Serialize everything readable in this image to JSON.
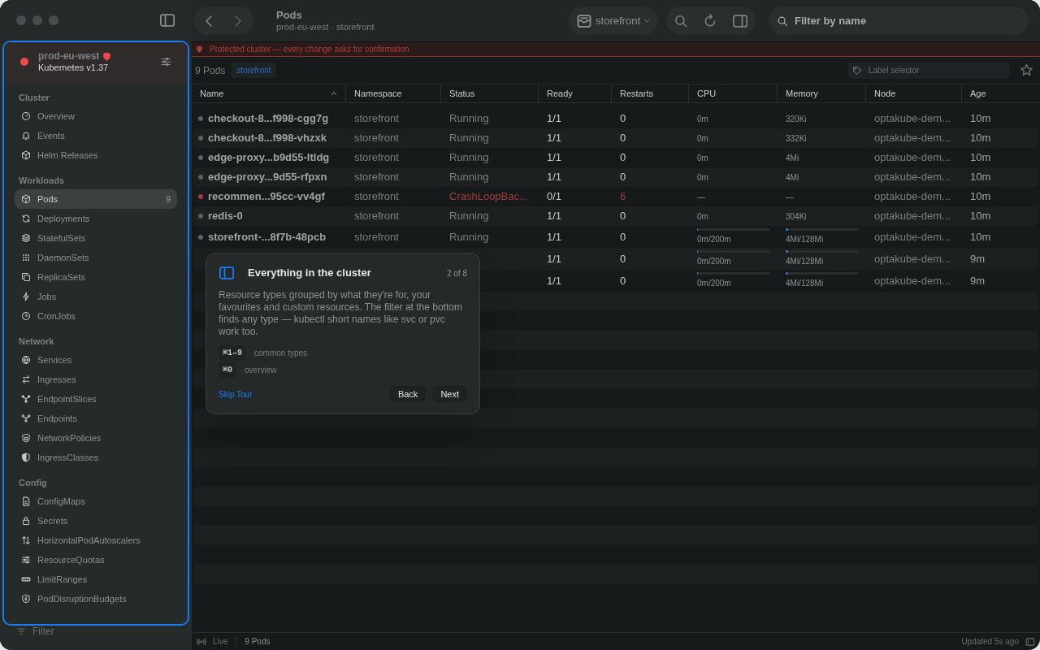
{
  "window": {
    "title": "Pods",
    "subtitle": "prod-eu-west · storefront"
  },
  "toolbar": {
    "namespace": "storefront",
    "search": {
      "placeholder": "Filter by name"
    }
  },
  "cluster": {
    "name": "prod-eu-west",
    "version": "Kubernetes v1.37",
    "protected": true
  },
  "sidebar": {
    "sections": [
      {
        "title": "Cluster",
        "items": [
          {
            "label": "Overview",
            "selected": false
          },
          {
            "label": "Events",
            "selected": false
          },
          {
            "label": "Helm Releases",
            "selected": false
          }
        ]
      },
      {
        "title": "Workloads",
        "items": [
          {
            "label": "Pods",
            "selected": true,
            "count": "9"
          },
          {
            "label": "Deployments",
            "selected": false
          },
          {
            "label": "StatefulSets",
            "selected": false
          },
          {
            "label": "DaemonSets",
            "selected": false
          },
          {
            "label": "ReplicaSets",
            "selected": false
          },
          {
            "label": "Jobs",
            "selected": false
          },
          {
            "label": "CronJobs",
            "selected": false
          }
        ]
      },
      {
        "title": "Network",
        "items": [
          {
            "label": "Services",
            "selected": false
          },
          {
            "label": "Ingresses",
            "selected": false
          },
          {
            "label": "EndpointSlices",
            "selected": false
          },
          {
            "label": "Endpoints",
            "selected": false
          },
          {
            "label": "NetworkPolicies",
            "selected": false
          },
          {
            "label": "IngressClasses",
            "selected": false
          }
        ]
      },
      {
        "title": "Config",
        "items": [
          {
            "label": "ConfigMaps",
            "selected": false
          },
          {
            "label": "Secrets",
            "selected": false
          },
          {
            "label": "HorizontalPodAutoscalers",
            "selected": false
          },
          {
            "label": "ResourceQuotas",
            "selected": false
          },
          {
            "label": "LimitRanges",
            "selected": false
          },
          {
            "label": "PodDisruptionBudgets",
            "selected": false
          }
        ]
      }
    ],
    "filter": "Filter"
  },
  "banner": "Protected cluster — every change asks for confirmation",
  "list_header": {
    "count": "9 Pods",
    "namespace_tag": "storefront",
    "label_selector": {
      "placeholder": "Label selector"
    }
  },
  "table": {
    "columns": [
      {
        "label": "Name",
        "sorted": true
      },
      {
        "label": "Namespace",
        "sorted": false
      },
      {
        "label": "Status",
        "sorted": false
      },
      {
        "label": "Ready",
        "sorted": false
      },
      {
        "label": "Restarts",
        "sorted": false
      },
      {
        "label": "CPU",
        "sorted": false
      },
      {
        "label": "Memory",
        "sorted": false
      },
      {
        "label": "Node",
        "sorted": false
      },
      {
        "label": "Age",
        "sorted": false
      }
    ],
    "rows": [
      {
        "name": "checkout-8...f998-cgg7g",
        "namespace": "storefront",
        "status": "Running",
        "failing": false,
        "ready": "1/1",
        "restarts": "0",
        "cpu": {
          "text": "0m"
        },
        "memory": {
          "text": "320Ki"
        },
        "node": "optakube-dem...",
        "age": "10m"
      },
      {
        "name": "checkout-8...f998-vhzxk",
        "namespace": "storefront",
        "status": "Running",
        "failing": false,
        "ready": "1/1",
        "restarts": "0",
        "cpu": {
          "text": "0m"
        },
        "memory": {
          "text": "332Ki"
        },
        "node": "optakube-dem...",
        "age": "10m"
      },
      {
        "name": "edge-proxy...b9d55-ltldg",
        "namespace": "storefront",
        "status": "Running",
        "failing": false,
        "ready": "1/1",
        "restarts": "0",
        "cpu": {
          "text": "0m"
        },
        "memory": {
          "text": "4Mi"
        },
        "node": "optakube-dem...",
        "age": "10m"
      },
      {
        "name": "edge-proxy...9d55-rfpxn",
        "namespace": "storefront",
        "status": "Running",
        "failing": false,
        "ready": "1/1",
        "restarts": "0",
        "cpu": {
          "text": "0m"
        },
        "memory": {
          "text": "4Mi"
        },
        "node": "optakube-dem...",
        "age": "10m"
      },
      {
        "name": "recommen...95cc-vv4gf",
        "namespace": "storefront",
        "status": "CrashLoopBac...",
        "failing": true,
        "ready": "0/1",
        "restarts": "6",
        "cpu": {
          "text": "—"
        },
        "memory": {
          "text": "—"
        },
        "node": "optakube-dem...",
        "age": "10m"
      },
      {
        "name": "redis-0",
        "namespace": "storefront",
        "status": "Running",
        "failing": false,
        "ready": "1/1",
        "restarts": "0",
        "cpu": {
          "text": "0m"
        },
        "memory": {
          "text": "304Ki"
        },
        "node": "optakube-dem...",
        "age": "10m"
      },
      {
        "name": "storefront-...8f7b-48pcb",
        "namespace": "storefront",
        "status": "Running",
        "failing": false,
        "ready": "1/1",
        "restarts": "0",
        "cpu": {
          "text": "0m/200m",
          "level": 0.01
        },
        "memory": {
          "text": "4Mi/128Mi",
          "level": 0.03
        },
        "node": "optakube-dem...",
        "age": "10m"
      },
      {
        "ready": "1/1",
        "restarts": "0",
        "failing": false,
        "cpu": {
          "text": "0m/200m",
          "level": 0.01
        },
        "memory": {
          "text": "4Mi/128Mi",
          "level": 0.03
        },
        "node": "optakube-dem...",
        "age": "9m"
      },
      {
        "ready": "1/1",
        "restarts": "0",
        "failing": false,
        "cpu": {
          "text": "0m/200m",
          "level": 0.01
        },
        "memory": {
          "text": "4Mi/128Mi",
          "level": 0.03
        },
        "node": "optakube-dem...",
        "age": "9m"
      }
    ]
  },
  "tour": {
    "title": "Everything in the cluster",
    "step": "2 of 8",
    "body": "Resource types grouped by what they're for, your favourites and custom resources. The filter at the bottom finds any type — kubectl short names like svc or pvc work too.",
    "shortcuts": [
      {
        "keys": "⌘1–9",
        "label": "common types"
      },
      {
        "keys": "⌘0",
        "label": "overview"
      }
    ],
    "skip": "Skip Tour",
    "back": "Back",
    "next": "Next"
  },
  "status_bar": {
    "live": "Live",
    "count": "9 Pods",
    "updated": "Updated 5s ago"
  }
}
